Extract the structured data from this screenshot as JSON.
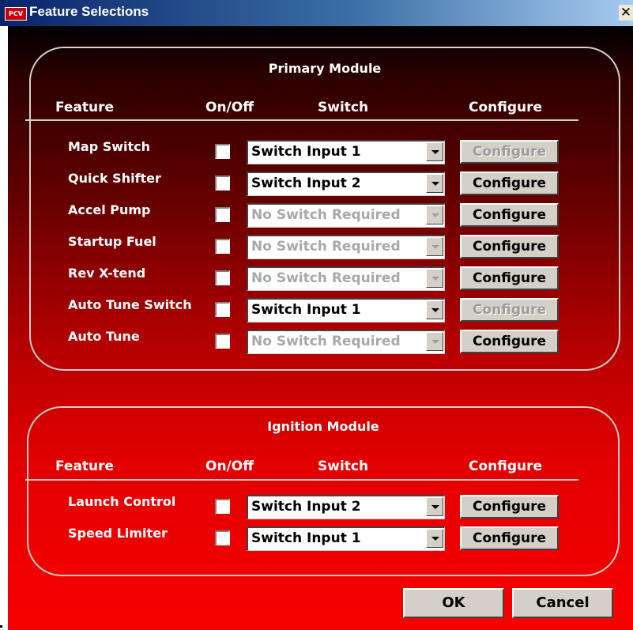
{
  "window": {
    "title": "Feature Selections",
    "app_icon_text": "PCV",
    "close_glyph": "✕"
  },
  "primary": {
    "title": "Primary Module",
    "headers": {
      "feature": "Feature",
      "onoff": "On/Off",
      "switch": "Switch",
      "configure": "Configure"
    },
    "rows": [
      {
        "feature": "Map Switch",
        "checked": false,
        "switch": "Switch Input 1",
        "switch_enabled": true,
        "configure": "Configure",
        "configure_enabled": false
      },
      {
        "feature": "Quick Shifter",
        "checked": false,
        "switch": "Switch Input 2",
        "switch_enabled": true,
        "configure": "Configure",
        "configure_enabled": true
      },
      {
        "feature": "Accel Pump",
        "checked": false,
        "switch": "No Switch Required",
        "switch_enabled": false,
        "configure": "Configure",
        "configure_enabled": true
      },
      {
        "feature": "Startup Fuel",
        "checked": false,
        "switch": "No Switch Required",
        "switch_enabled": false,
        "configure": "Configure",
        "configure_enabled": true
      },
      {
        "feature": "Rev X-tend",
        "checked": false,
        "switch": "No Switch Required",
        "switch_enabled": false,
        "configure": "Configure",
        "configure_enabled": true
      },
      {
        "feature": "Auto Tune Switch",
        "checked": false,
        "switch": "Switch Input 1",
        "switch_enabled": true,
        "configure": "Configure",
        "configure_enabled": false
      },
      {
        "feature": "Auto Tune",
        "checked": false,
        "switch": "No Switch Required",
        "switch_enabled": false,
        "configure": "Configure",
        "configure_enabled": true
      }
    ]
  },
  "ignition": {
    "title": "Ignition Module",
    "headers": {
      "feature": "Feature",
      "onoff": "On/Off",
      "switch": "Switch",
      "configure": "Configure"
    },
    "rows": [
      {
        "feature": "Launch Control",
        "checked": false,
        "switch": "Switch Input 2",
        "switch_enabled": true,
        "configure": "Configure",
        "configure_enabled": true
      },
      {
        "feature": "Speed Limiter",
        "checked": false,
        "switch": "Switch Input 1",
        "switch_enabled": true,
        "configure": "Configure",
        "configure_enabled": true
      }
    ]
  },
  "footer": {
    "ok": "OK",
    "cancel": "Cancel"
  },
  "colors": {
    "title_bar": "#0a246a",
    "accent_red": "#e20000",
    "button_face": "#d4d0c8"
  }
}
